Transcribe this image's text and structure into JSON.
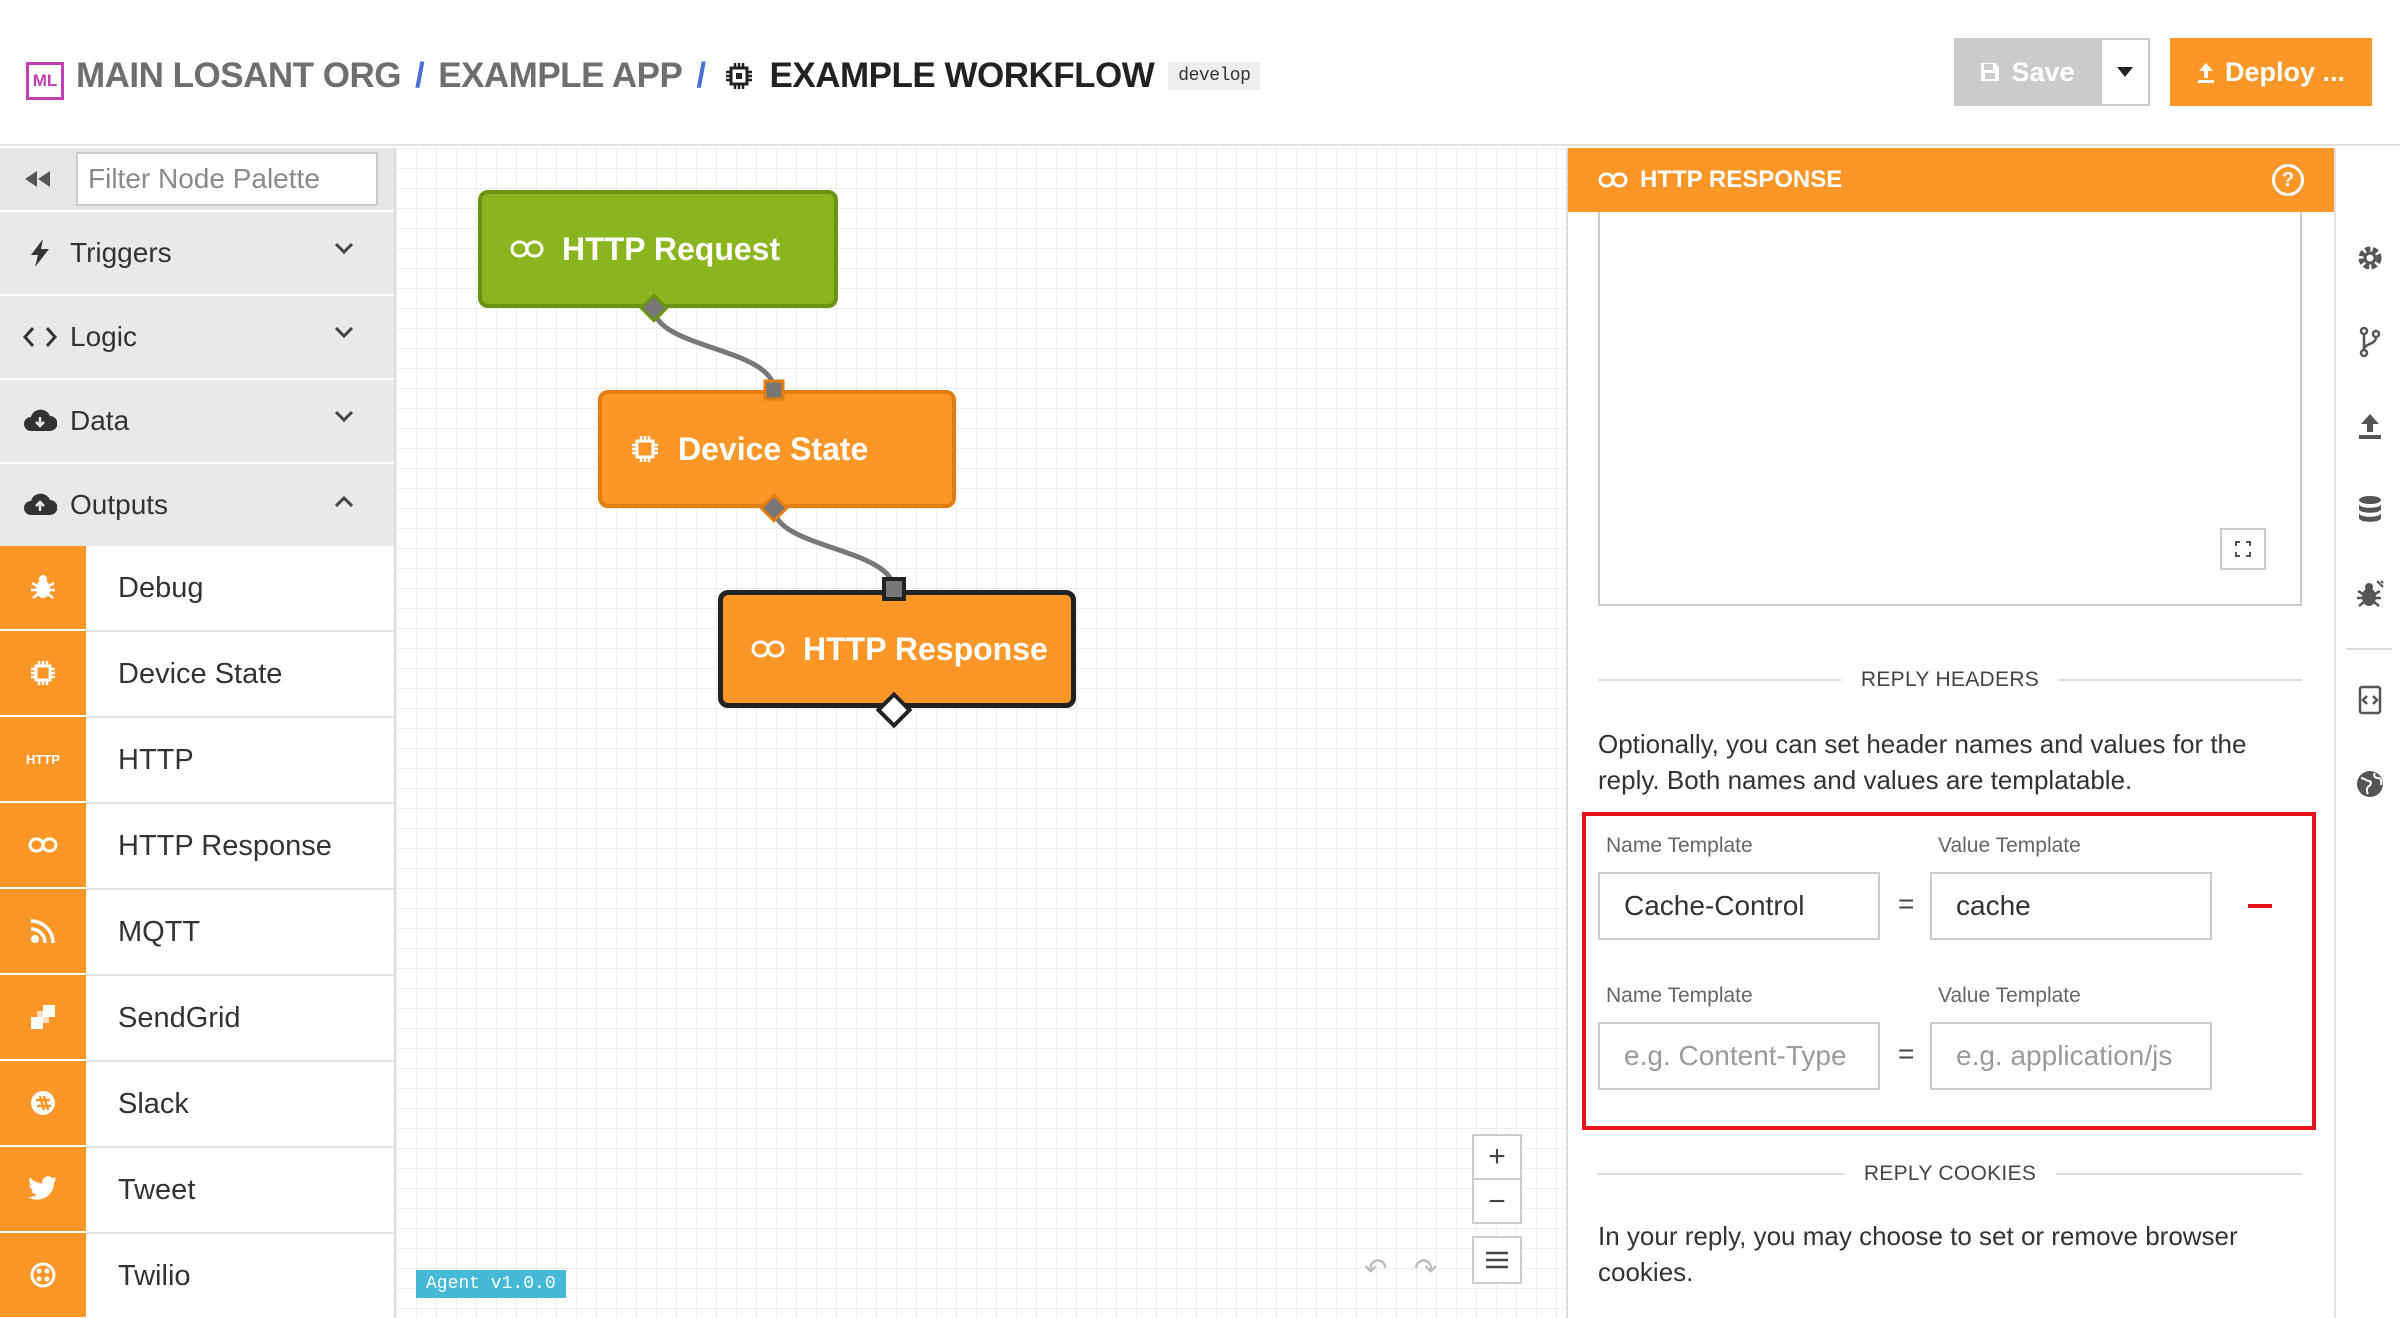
{
  "header": {
    "logo_text": "ML",
    "org": "MAIN LOSANT ORG",
    "separator": "/",
    "app": "EXAMPLE APP",
    "workflow": "EXAMPLE WORKFLOW",
    "branch": "develop",
    "save_label": "Save",
    "deploy_label": "Deploy ..."
  },
  "palette": {
    "filter_placeholder": "Filter Node Palette",
    "categories": [
      {
        "label": "Triggers",
        "icon": "bolt-icon",
        "expanded": false
      },
      {
        "label": "Logic",
        "icon": "code-icon",
        "expanded": false
      },
      {
        "label": "Data",
        "icon": "cloud-download-icon",
        "expanded": false
      },
      {
        "label": "Outputs",
        "icon": "cloud-upload-icon",
        "expanded": true
      }
    ],
    "output_nodes": [
      {
        "label": "Debug",
        "icon": "bug-icon"
      },
      {
        "label": "Device State",
        "icon": "device-chip-icon"
      },
      {
        "label": "HTTP",
        "icon": "http-text-icon",
        "icon_text": "HTTP"
      },
      {
        "label": "HTTP Response",
        "icon": "link-icon"
      },
      {
        "label": "MQTT",
        "icon": "rss-icon"
      },
      {
        "label": "SendGrid",
        "icon": "sendgrid-icon"
      },
      {
        "label": "Slack",
        "icon": "slack-icon"
      },
      {
        "label": "Tweet",
        "icon": "twitter-bird-icon"
      },
      {
        "label": "Twilio",
        "icon": "twilio-icon"
      }
    ]
  },
  "canvas": {
    "nodes": [
      {
        "label": "HTTP Request",
        "icon": "link-icon",
        "color": "#8ab51f"
      },
      {
        "label": "Device State",
        "icon": "device-chip-icon",
        "color": "#fc9627"
      },
      {
        "label": "HTTP Response",
        "icon": "link-icon",
        "color": "#fc9627",
        "selected": true
      }
    ],
    "zoom_in": "+",
    "zoom_out": "−",
    "agent_version": "Agent v1.0.0"
  },
  "panel": {
    "title": "HTTP RESPONSE",
    "reply_headers_title": "REPLY HEADERS",
    "reply_headers_desc": "Optionally, you can set header names and values for the reply. Both names and values are templatable.",
    "headers": [
      {
        "name_label": "Name Template",
        "value_label": "Value Template",
        "name_value": "Cache-Control",
        "value_value": "cache",
        "name_placeholder": "",
        "value_placeholder": ""
      },
      {
        "name_label": "Name Template",
        "value_label": "Value Template",
        "name_value": "",
        "value_value": "",
        "name_placeholder": "e.g. Content-Type",
        "value_placeholder": "e.g. application/js"
      }
    ],
    "equals": "=",
    "reply_cookies_title": "REPLY COOKIES",
    "reply_cookies_desc": "In your reply, you may choose to set or remove browser cookies."
  },
  "colors": {
    "accent_orange": "#fc9627",
    "trigger_green": "#8ab51f",
    "highlight_red": "#e8141c",
    "brand_magenta": "#c13fae"
  }
}
